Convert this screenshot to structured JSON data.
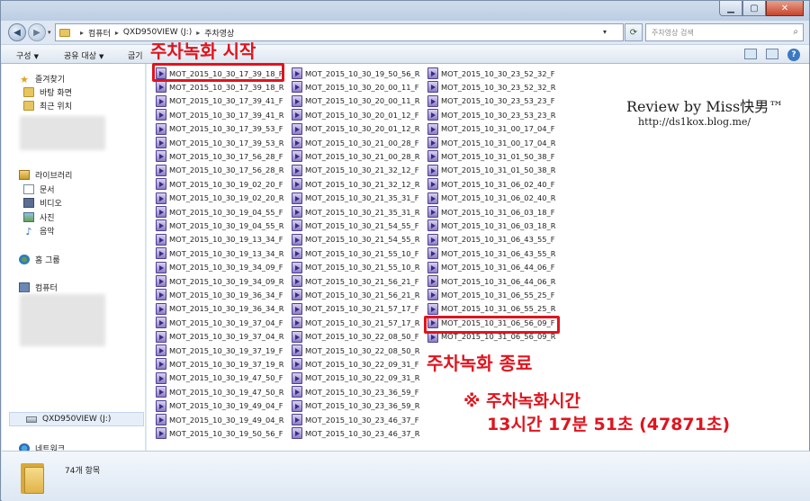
{
  "window": {
    "controls": {
      "minimize": "▁",
      "maximize": "▢",
      "close": "✕"
    }
  },
  "address": {
    "crumbs": [
      "컴퓨터",
      "QXD950VIEW (J:)",
      "주차영상"
    ],
    "search_placeholder": "주차영상 검색"
  },
  "toolbar": {
    "organize": "구성",
    "share": "공유 대상",
    "burn": "굽기"
  },
  "nav": {
    "favorites": "즐겨찾기",
    "desktop": "바탕 화면",
    "recent": "최근 위치",
    "libraries": "라이브러리",
    "documents": "문서",
    "videos": "비디오",
    "pictures": "사진",
    "music": "음악",
    "homegroup": "홈 그룹",
    "computer": "컴퓨터",
    "drive": "QXD950VIEW (J:)",
    "network": "네트워크"
  },
  "files": {
    "col1": [
      "MOT_2015_10_30_17_39_18_F",
      "MOT_2015_10_30_17_39_18_R",
      "MOT_2015_10_30_17_39_41_F",
      "MOT_2015_10_30_17_39_41_R",
      "MOT_2015_10_30_17_39_53_F",
      "MOT_2015_10_30_17_39_53_R",
      "MOT_2015_10_30_17_56_28_F",
      "MOT_2015_10_30_17_56_28_R",
      "MOT_2015_10_30_19_02_20_F",
      "MOT_2015_10_30_19_02_20_R",
      "MOT_2015_10_30_19_04_55_F",
      "MOT_2015_10_30_19_04_55_R",
      "MOT_2015_10_30_19_13_34_F",
      "MOT_2015_10_30_19_13_34_R",
      "MOT_2015_10_30_19_34_09_F",
      "MOT_2015_10_30_19_34_09_R",
      "MOT_2015_10_30_19_36_34_F",
      "MOT_2015_10_30_19_36_34_R",
      "MOT_2015_10_30_19_37_04_F",
      "MOT_2015_10_30_19_37_04_R",
      "MOT_2015_10_30_19_37_19_F",
      "MOT_2015_10_30_19_37_19_R",
      "MOT_2015_10_30_19_47_50_F",
      "MOT_2015_10_30_19_47_50_R",
      "MOT_2015_10_30_19_49_04_F",
      "MOT_2015_10_30_19_49_04_R",
      "MOT_2015_10_30_19_50_56_F"
    ],
    "col2": [
      "MOT_2015_10_30_19_50_56_R",
      "MOT_2015_10_30_20_00_11_F",
      "MOT_2015_10_30_20_00_11_R",
      "MOT_2015_10_30_20_01_12_F",
      "MOT_2015_10_30_20_01_12_R",
      "MOT_2015_10_30_21_00_28_F",
      "MOT_2015_10_30_21_00_28_R",
      "MOT_2015_10_30_21_32_12_F",
      "MOT_2015_10_30_21_32_12_R",
      "MOT_2015_10_30_21_35_31_F",
      "MOT_2015_10_30_21_35_31_R",
      "MOT_2015_10_30_21_54_55_F",
      "MOT_2015_10_30_21_54_55_R",
      "MOT_2015_10_30_21_55_10_F",
      "MOT_2015_10_30_21_55_10_R",
      "MOT_2015_10_30_21_56_21_F",
      "MOT_2015_10_30_21_56_21_R",
      "MOT_2015_10_30_21_57_17_F",
      "MOT_2015_10_30_21_57_17_R",
      "MOT_2015_10_30_22_08_50_F",
      "MOT_2015_10_30_22_08_50_R",
      "MOT_2015_10_30_22_09_31_F",
      "MOT_2015_10_30_22_09_31_R",
      "MOT_2015_10_30_23_36_59_F",
      "MOT_2015_10_30_23_36_59_R",
      "MOT_2015_10_30_23_46_37_F",
      "MOT_2015_10_30_23_46_37_R"
    ],
    "col3": [
      "MOT_2015_10_30_23_52_32_F",
      "MOT_2015_10_30_23_52_32_R",
      "MOT_2015_10_30_23_53_23_F",
      "MOT_2015_10_30_23_53_23_R",
      "MOT_2015_10_31_00_17_04_F",
      "MOT_2015_10_31_00_17_04_R",
      "MOT_2015_10_31_01_50_38_F",
      "MOT_2015_10_31_01_50_38_R",
      "MOT_2015_10_31_06_02_40_F",
      "MOT_2015_10_31_06_02_40_R",
      "MOT_2015_10_31_06_03_18_F",
      "MOT_2015_10_31_06_03_18_R",
      "MOT_2015_10_31_06_43_55_F",
      "MOT_2015_10_31_06_43_55_R",
      "MOT_2015_10_31_06_44_06_F",
      "MOT_2015_10_31_06_44_06_R",
      "MOT_2015_10_31_06_55_25_F",
      "MOT_2015_10_31_06_55_25_R",
      "MOT_2015_10_31_06_56_09_F",
      "MOT_2015_10_31_06_56_09_R"
    ]
  },
  "annotations": {
    "start": "주차녹화 시작",
    "end": "주차녹화 종료",
    "note_line1": "※ 주차녹화시간",
    "note_line2": "13시간 17분 51초 (47871초)",
    "color": "#e0141e"
  },
  "watermark": {
    "line1": "Review by Miss快男™",
    "line2": "http://ds1kox.blog.me/"
  },
  "status": {
    "item_count": "74개 항목"
  }
}
